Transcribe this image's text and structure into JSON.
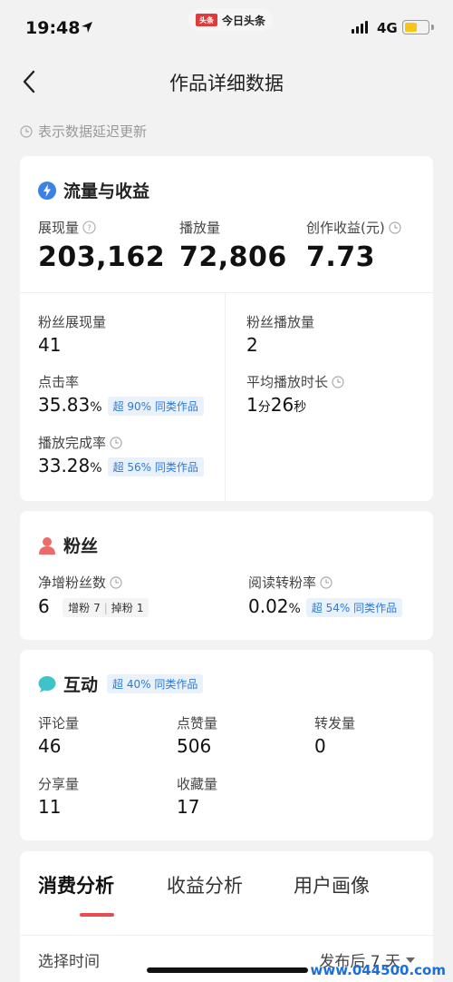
{
  "status": {
    "time": "19:48",
    "app_logo": "头条",
    "app_name": "今日头条",
    "network": "4G",
    "battery_level": 0.55
  },
  "nav": {
    "title": "作品详细数据"
  },
  "delay_note": "表示数据延迟更新",
  "traffic": {
    "title": "流量与收益",
    "impressions_label": "展现量",
    "impressions": "203,162",
    "plays_label": "播放量",
    "plays": "72,806",
    "income_label": "创作收益(元)",
    "income": "7.73",
    "fan_impressions_label": "粉丝展现量",
    "fan_impressions": "41",
    "fan_plays_label": "粉丝播放量",
    "fan_plays": "2",
    "ctr_label": "点击率",
    "ctr_value": "35.83",
    "ctr_unit": "%",
    "ctr_badge": "超 90% 同类作品",
    "avg_duration_label": "平均播放时长",
    "avg_min": "1",
    "avg_min_unit": "分",
    "avg_sec": "26",
    "avg_sec_unit": "秒",
    "completion_label": "播放完成率",
    "completion_value": "33.28",
    "completion_unit": "%",
    "completion_badge": "超 56% 同类作品"
  },
  "fans": {
    "title": "粉丝",
    "net_label": "净增粉丝数",
    "net_value": "6",
    "gain_label": "增粉",
    "gain_value": "7",
    "loss_label": "掉粉",
    "loss_value": "1",
    "conv_label": "阅读转粉率",
    "conv_value": "0.02",
    "conv_unit": "%",
    "conv_badge": "超 54% 同类作品"
  },
  "interaction": {
    "title": "互动",
    "badge": "超 40% 同类作品",
    "comments_label": "评论量",
    "comments": "46",
    "likes_label": "点赞量",
    "likes": "506",
    "reposts_label": "转发量",
    "reposts": "0",
    "shares_label": "分享量",
    "shares": "11",
    "favorites_label": "收藏量",
    "favorites": "17"
  },
  "tabs": {
    "items": [
      "消费分析",
      "收益分析",
      "用户画像"
    ],
    "active_index": 0
  },
  "time_select": {
    "label": "选择时间",
    "value": "发布后 7 天"
  },
  "watermark": "www.044500.com",
  "colors": {
    "accent_red": "#e84c4c",
    "badge_blue": "#2d7bd6",
    "battery": "#f5c518"
  }
}
